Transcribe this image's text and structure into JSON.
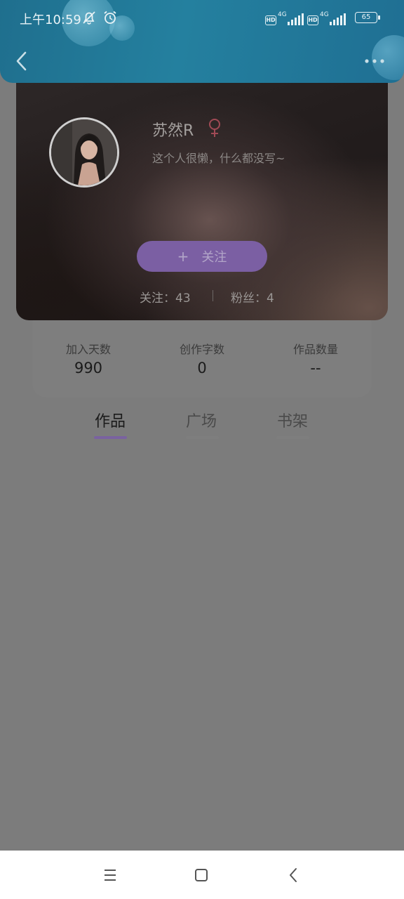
{
  "status_bar": {
    "time": "上午10:59",
    "hd_label": "HD",
    "network_1": "4G",
    "network_2": "4G",
    "battery": "65"
  },
  "profile": {
    "username": "苏然R",
    "gender": "female",
    "bio": "这个人很懒，什么都没写~",
    "follow_button": {
      "icon": "+",
      "label": "关注"
    },
    "following": "关注：43",
    "fans": "粉丝：4"
  },
  "stats": [
    {
      "label": "加入天数",
      "value": "990"
    },
    {
      "label": "创作字数",
      "value": "0"
    },
    {
      "label": "作品数量",
      "value": "--"
    }
  ],
  "tabs": [
    {
      "label": "作品",
      "active": true
    },
    {
      "label": "广场",
      "active": false
    },
    {
      "label": "书架",
      "active": false
    }
  ],
  "colors": {
    "accent": "#7b5fa3",
    "header": "#24809f",
    "gender_icon": "#a04a55",
    "overlay": "#7c7c7c"
  },
  "icons": {
    "back": "chevron-left-icon",
    "more": "more-dots-icon",
    "gender": "female-symbol-icon",
    "nav_menu": "menu-icon",
    "nav_home": "home-square-icon",
    "nav_back": "back-arrow-icon"
  }
}
